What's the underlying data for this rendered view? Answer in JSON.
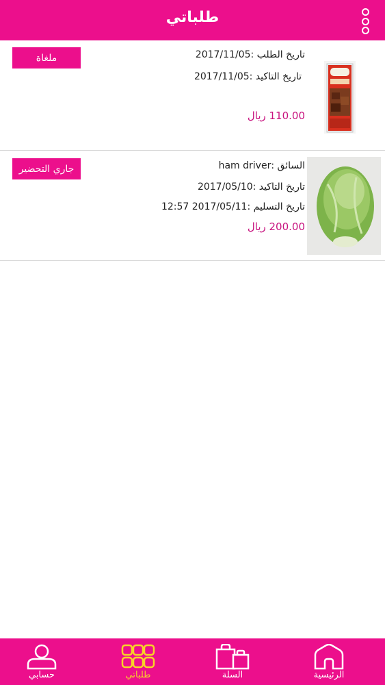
{
  "header": {
    "title": "طلباتي"
  },
  "orders": [
    {
      "status": "ملغاة",
      "order_date": "تاريخ الطلب :2017/11/05",
      "confirm_date": "تاريخ التاكيد :2017/11/05",
      "price": "110.00 ريال"
    },
    {
      "status": "جاري التحضير",
      "driver": "السائق :ham driver",
      "confirm_date": "تاريخ التاكيد :2017/05/10",
      "delivery_date": "تاريخ التسليم :2017/05/11 12:57",
      "price": "200.00 ريال"
    }
  ],
  "bottom_nav": {
    "account": "حسابي",
    "orders": "طلباتي",
    "cart": "السلة",
    "home": "الرئيسية"
  },
  "colors": {
    "brand": "#ec0f8c",
    "price": "#c8137f",
    "active_tab": "#f7d327"
  },
  "icons": {
    "menu": "kebab-menu-icon",
    "account": "user-icon",
    "orders": "grid-icon",
    "cart": "shopping-bags-icon",
    "home": "home-icon"
  }
}
